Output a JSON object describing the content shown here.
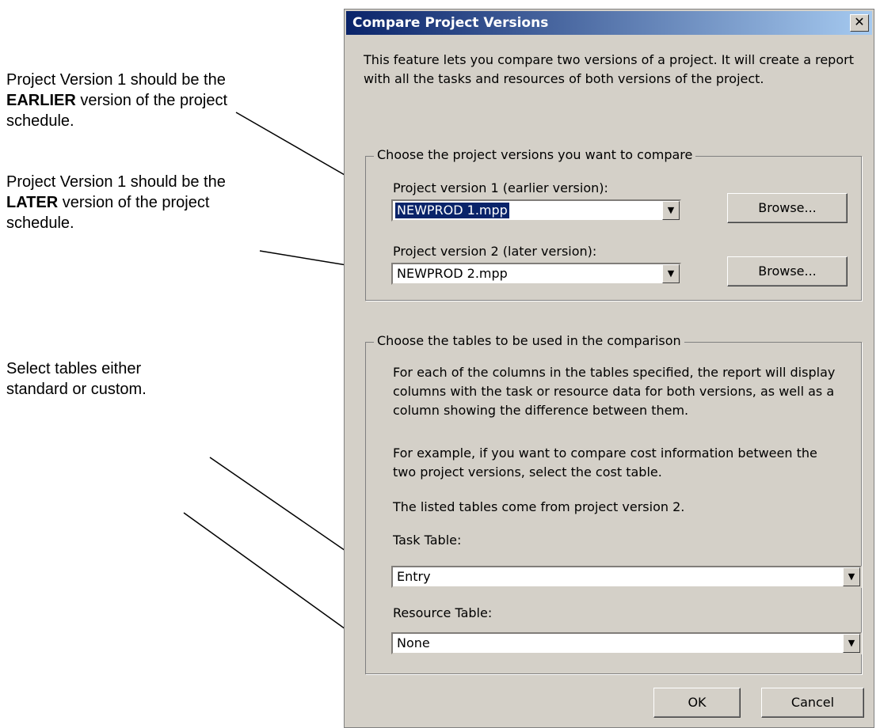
{
  "annotations": {
    "note1": {
      "before": "Project Version 1 should be the ",
      "bold": "EARLIER",
      "after": " version of the project schedule."
    },
    "note2": {
      "before": "Project Version 1 should be the ",
      "bold": "LATER",
      "after": " version of the project schedule."
    },
    "note3": "Select tables either standard or custom."
  },
  "dialog": {
    "title": "Compare Project Versions",
    "close_symbol": "✕",
    "intro": "This feature lets you compare two versions of a project. It will create a report with all the tasks and resources of both versions of the project.",
    "versions_group": {
      "legend": "Choose the project versions you want to compare",
      "version1_label": "Project version 1 (earlier version):",
      "version1_value": "NEWPROD 1.mpp",
      "version2_label": "Project version 2 (later version):",
      "version2_value": "NEWPROD 2.mpp",
      "browse_label": "Browse..."
    },
    "tables_group": {
      "legend": "Choose the tables to be used in the comparison",
      "desc1": "For each of the columns in the tables specified, the report will display columns with the task or resource data for both versions, as well as a column showing the difference between them.",
      "desc2": "For example, if you want to compare cost information between the two project versions, select the cost table.",
      "desc3": "The listed tables come from project version 2.",
      "task_label": "Task Table:",
      "task_value": "Entry",
      "resource_label": "Resource Table:",
      "resource_value": "None"
    },
    "ok_label": "OK",
    "cancel_label": "Cancel"
  },
  "icons": {
    "dropdown": "chevron-down-icon",
    "close": "close-icon"
  },
  "colors": {
    "title_start": "#0a246a",
    "title_end": "#a6caf0",
    "face": "#d4d0c8"
  }
}
